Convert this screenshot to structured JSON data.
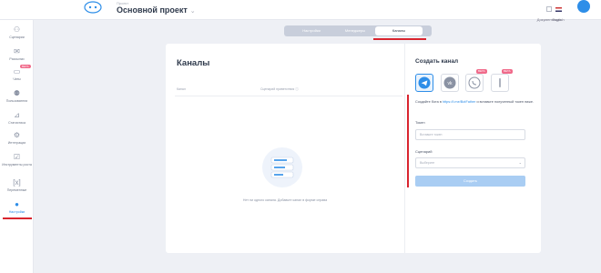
{
  "header": {
    "project_caption": "Проект",
    "project_title": "Основной проект",
    "docs_label": "Документация",
    "lang_label": "English"
  },
  "sidebar": {
    "items": [
      {
        "label": "Сценарии",
        "icon": "scenarios-icon"
      },
      {
        "label": "Рассылки",
        "icon": "mail-icon"
      },
      {
        "label": "Чаты",
        "icon": "chat-icon",
        "badge": "beta"
      },
      {
        "label": "Пользователи",
        "icon": "users-icon"
      },
      {
        "label": "Статистика",
        "icon": "stats-icon"
      },
      {
        "label": "Интеграции",
        "icon": "integrations-icon"
      },
      {
        "label": "Инструменты роста",
        "icon": "growth-icon"
      },
      {
        "label": "Переменные",
        "icon": "variables-icon"
      },
      {
        "label": "Настройки",
        "icon": "settings-icon",
        "active": true
      }
    ]
  },
  "tabs": [
    {
      "label": "Настройки",
      "active": false
    },
    {
      "label": "Менеджеры",
      "active": false
    },
    {
      "label": "Каналы",
      "active": true
    }
  ],
  "channels": {
    "title": "Каналы",
    "col_channel": "Канал",
    "col_scenario": "Сценарий приветствия",
    "empty_text": "Нет ни одного канала. Добавьте канал в форме справа"
  },
  "create": {
    "title": "Создать канал",
    "channel_icons": [
      "telegram-icon",
      "vk-icon",
      "viber-icon",
      "more-icon"
    ],
    "beta_label": "BETA",
    "hint_prefix": "Создайте бота в ",
    "hint_link": "https://t.me/BotFather",
    "hint_suffix": " и вставьте полученный токен ниже.",
    "token_label": "Токен",
    "token_placeholder": "Вставьте токен",
    "scenario_label": "Сценарий",
    "scenario_value": "Выберите",
    "create_button": "Создать"
  },
  "colors": {
    "accent": "#2e8ee8",
    "highlight": "#d9242e",
    "beta": "#f06a8a"
  }
}
